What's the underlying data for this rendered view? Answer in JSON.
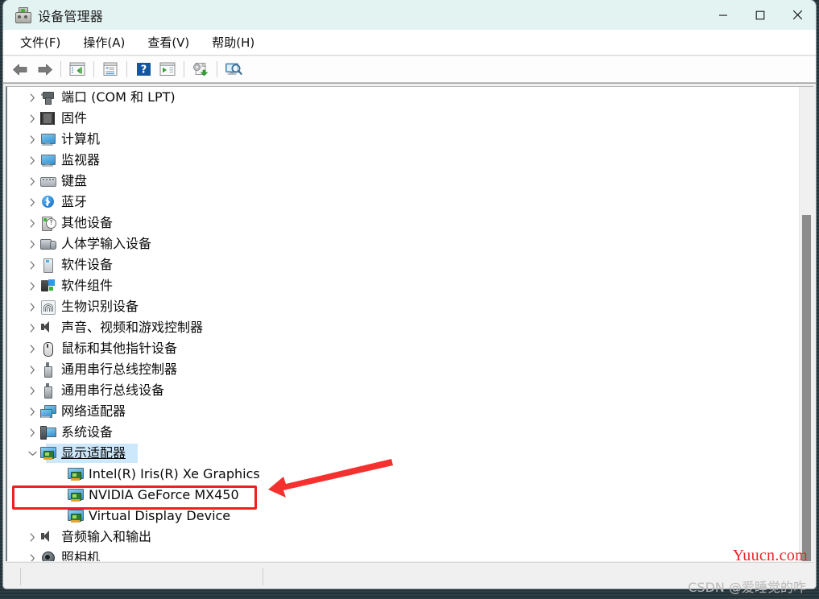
{
  "window": {
    "title": "设备管理器",
    "icon": "device-manager-icon",
    "controls": {
      "minimize": "最小化",
      "maximize": "最大化",
      "close": "关闭"
    }
  },
  "menubar": {
    "items": [
      {
        "label": "文件(F)",
        "name": "menu-file"
      },
      {
        "label": "操作(A)",
        "name": "menu-action"
      },
      {
        "label": "查看(V)",
        "name": "menu-view"
      },
      {
        "label": "帮助(H)",
        "name": "menu-help"
      }
    ]
  },
  "toolbar": {
    "buttons": [
      {
        "name": "back-button",
        "icon": "arrow-left-icon",
        "title": "后退"
      },
      {
        "name": "forward-button",
        "icon": "arrow-right-icon",
        "title": "前进"
      },
      {
        "name": "separator-1",
        "icon": "separator"
      },
      {
        "name": "show-hide-console-tree-button",
        "icon": "console-tree-icon",
        "title": "显示/隐藏控制台树"
      },
      {
        "name": "separator-2",
        "icon": "separator"
      },
      {
        "name": "properties-button",
        "icon": "properties-icon",
        "title": "属性"
      },
      {
        "name": "separator-3",
        "icon": "separator"
      },
      {
        "name": "help-button",
        "icon": "help-question-icon",
        "title": "帮助"
      },
      {
        "name": "update-driver-button",
        "icon": "update-driver-icon",
        "title": "更新驱动程序"
      },
      {
        "name": "separator-4",
        "icon": "separator"
      },
      {
        "name": "scan-hardware-changes-button",
        "icon": "scan-hardware-icon",
        "title": "扫描检测硬件改动"
      },
      {
        "name": "separator-5",
        "icon": "separator"
      },
      {
        "name": "show-all-devices-button",
        "icon": "display-search-icon",
        "title": "显示所有设备"
      }
    ]
  },
  "tree": {
    "rows": [
      {
        "label": "端口 (COM 和 LPT)",
        "icon": "port-icon",
        "iconClass": "i-port",
        "expandable": true,
        "expanded": false,
        "child": false,
        "selected": false
      },
      {
        "label": "固件",
        "icon": "firmware-chip-icon",
        "iconClass": "i-fw",
        "expandable": true,
        "expanded": false,
        "child": false,
        "selected": false
      },
      {
        "label": "计算机",
        "icon": "computer-monitor-icon",
        "iconClass": "i-mon",
        "expandable": true,
        "expanded": false,
        "child": false,
        "selected": false
      },
      {
        "label": "监视器",
        "icon": "monitor-icon",
        "iconClass": "i-mon",
        "expandable": true,
        "expanded": false,
        "child": false,
        "selected": false
      },
      {
        "label": "键盘",
        "icon": "keyboard-icon",
        "iconClass": "i-kb",
        "expandable": true,
        "expanded": false,
        "child": false,
        "selected": false
      },
      {
        "label": "蓝牙",
        "icon": "bluetooth-icon",
        "iconClass": "i-bt",
        "expandable": true,
        "expanded": false,
        "child": false,
        "selected": false
      },
      {
        "label": "其他设备",
        "icon": "unknown-device-icon",
        "iconClass": "i-other",
        "expandable": true,
        "expanded": false,
        "child": false,
        "selected": false
      },
      {
        "label": "人体学输入设备",
        "icon": "hid-device-icon",
        "iconClass": "i-hid",
        "expandable": true,
        "expanded": false,
        "child": false,
        "selected": false
      },
      {
        "label": "软件设备",
        "icon": "software-device-icon",
        "iconClass": "i-sd",
        "expandable": true,
        "expanded": false,
        "child": false,
        "selected": false
      },
      {
        "label": "软件组件",
        "icon": "software-component-icon",
        "iconClass": "i-sc",
        "expandable": true,
        "expanded": false,
        "child": false,
        "selected": false
      },
      {
        "label": "生物识别设备",
        "icon": "biometric-fingerprint-icon",
        "iconClass": "i-bio",
        "expandable": true,
        "expanded": false,
        "child": false,
        "selected": false
      },
      {
        "label": "声音、视频和游戏控制器",
        "icon": "speaker-icon",
        "iconClass": "i-snd",
        "expandable": true,
        "expanded": false,
        "child": false,
        "selected": false
      },
      {
        "label": "鼠标和其他指针设备",
        "icon": "mouse-icon",
        "iconClass": "i-mouse",
        "expandable": true,
        "expanded": false,
        "child": false,
        "selected": false
      },
      {
        "label": "通用串行总线控制器",
        "icon": "usb-controller-icon",
        "iconClass": "i-usb",
        "expandable": true,
        "expanded": false,
        "child": false,
        "selected": false
      },
      {
        "label": "通用串行总线设备",
        "icon": "usb-device-icon",
        "iconClass": "i-usbd",
        "expandable": true,
        "expanded": false,
        "child": false,
        "selected": false
      },
      {
        "label": "网络适配器",
        "icon": "network-adapter-icon",
        "iconClass": "i-net",
        "expandable": true,
        "expanded": false,
        "child": false,
        "selected": false
      },
      {
        "label": "系统设备",
        "icon": "system-device-icon",
        "iconClass": "i-sys",
        "expandable": true,
        "expanded": false,
        "child": false,
        "selected": false
      },
      {
        "label": "显示适配器",
        "icon": "display-adapter-icon",
        "iconClass": "i-disp",
        "expandable": true,
        "expanded": true,
        "child": false,
        "selected": true
      },
      {
        "label": "Intel(R) Iris(R) Xe Graphics",
        "icon": "display-adapter-icon",
        "iconClass": "i-disp",
        "expandable": false,
        "expanded": false,
        "child": true,
        "selected": false
      },
      {
        "label": "NVIDIA GeForce MX450",
        "icon": "display-adapter-icon",
        "iconClass": "i-disp",
        "expandable": false,
        "expanded": false,
        "child": true,
        "selected": false,
        "highlighted": true
      },
      {
        "label": "Virtual Display Device",
        "icon": "display-adapter-icon",
        "iconClass": "i-disp",
        "expandable": false,
        "expanded": false,
        "child": true,
        "selected": false
      },
      {
        "label": "音频输入和输出",
        "icon": "audio-io-icon",
        "iconClass": "i-audio",
        "expandable": true,
        "expanded": false,
        "child": false,
        "selected": false
      },
      {
        "label": "照相机",
        "icon": "camera-icon",
        "iconClass": "i-cam",
        "expandable": true,
        "expanded": false,
        "child": false,
        "selected": false
      }
    ]
  },
  "scrollbar": {
    "name": "vertical-scrollbar",
    "thumb_top_pct": 27,
    "thumb_height_pct": 73
  },
  "statusbar": {
    "text": ""
  },
  "annotations": {
    "highlight_box": {
      "name": "red-highlight-box",
      "color": "#f02020",
      "target": "NVIDIA GeForce MX450"
    },
    "arrow": {
      "name": "red-pointer-arrow",
      "color": "#f5312f",
      "from": "右上",
      "to": "NVIDIA GeForce MX450"
    }
  },
  "watermarks": {
    "red": "Yuucn.com",
    "gray": "CSDN @爱睡觉的咋"
  },
  "colors": {
    "titlebar": "#e3f3f1",
    "selection": "#cde8fa",
    "annotation_red": "#f02020",
    "watermark_red": "#e8262b",
    "watermark_gray": "#b9b9b9"
  }
}
